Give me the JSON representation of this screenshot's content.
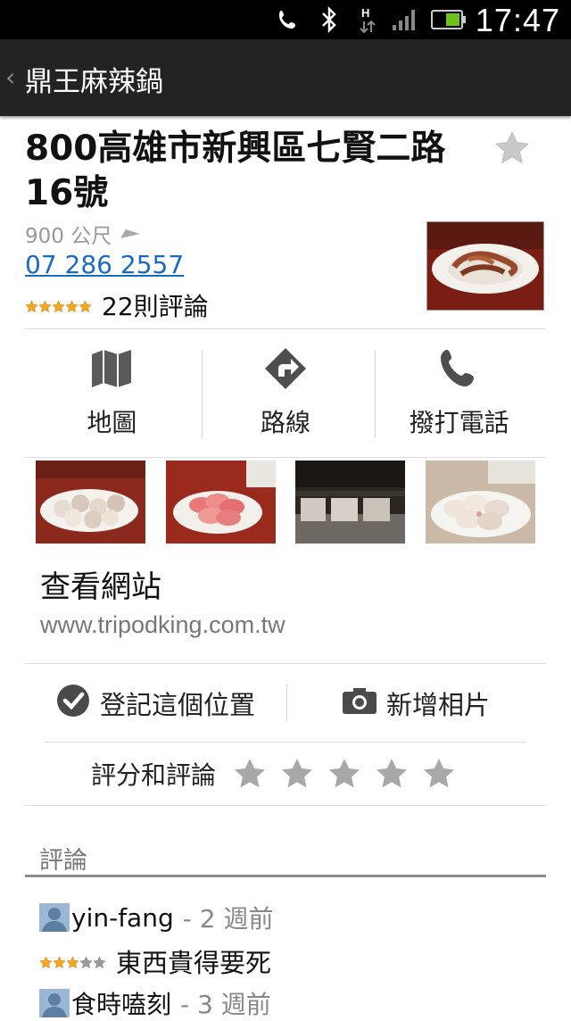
{
  "status_bar": {
    "time": "17:47"
  },
  "action_bar": {
    "title": "鼎王麻辣鍋"
  },
  "place": {
    "address": "800高雄市新興區七賢二路16號",
    "distance": "900 公尺",
    "phone": "07 286 2557",
    "rating_stars": 5,
    "review_count_label": "22則評論"
  },
  "actions": [
    {
      "label": "地圖",
      "icon": "map-icon"
    },
    {
      "label": "路線",
      "icon": "directions-icon"
    },
    {
      "label": "撥打電話",
      "icon": "phone-icon"
    }
  ],
  "website": {
    "label": "查看網站",
    "url": "www.tripodking.com.tw"
  },
  "checkin": {
    "checkin_label": "登記這個位置",
    "add_photo_label": "新增相片"
  },
  "rate": {
    "label": "評分和評論",
    "stars": 5
  },
  "reviews": {
    "heading": "評論",
    "items": [
      {
        "author": "yin-fang",
        "ago": "- 2 週前",
        "rating": 3,
        "text": "東西貴得要死"
      },
      {
        "author": "食時嗑刻",
        "ago": "- 3 週前"
      }
    ]
  },
  "colors": {
    "link": "#1a6bbf",
    "star_orange": "#f5a623",
    "action_bar": "#232323"
  }
}
